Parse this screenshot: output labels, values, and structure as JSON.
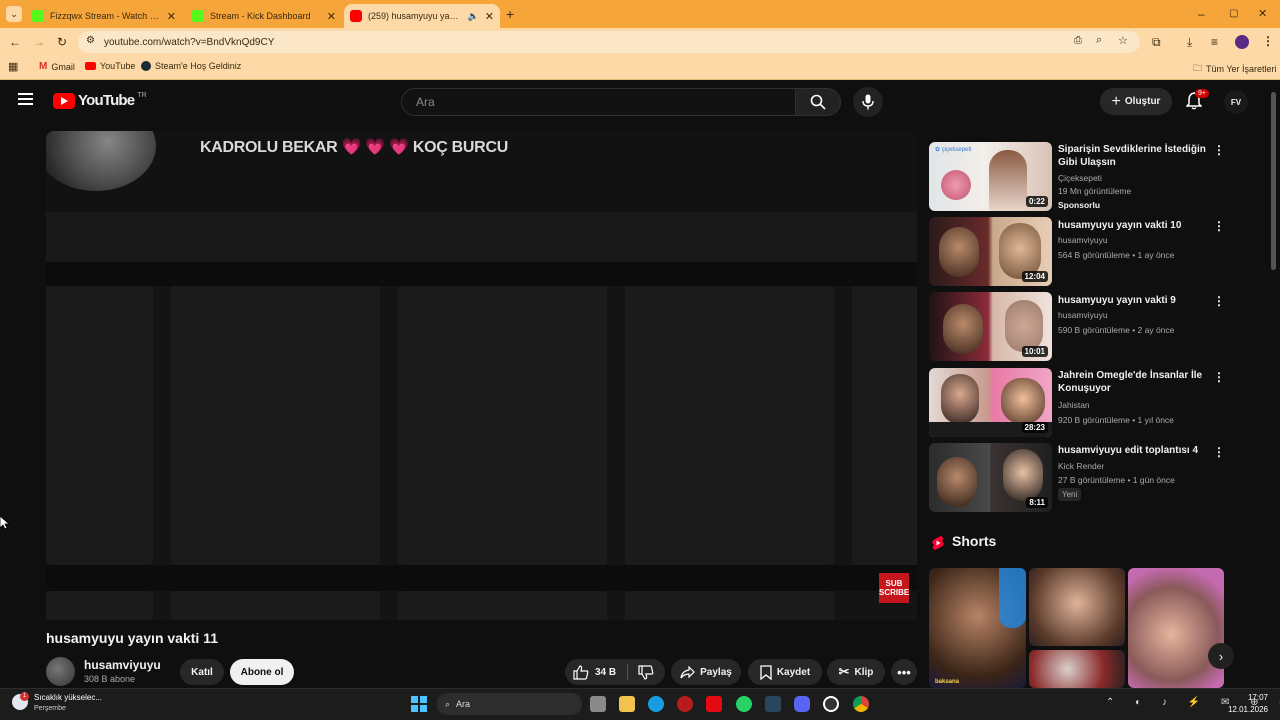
{
  "browser": {
    "tabs": [
      {
        "title": "Fizzqwx Stream - Watch Live on Kick",
        "favicon_color": "#53fc18"
      },
      {
        "title": "Stream - Kick Dashboard",
        "favicon_color": "#53fc18"
      },
      {
        "title": "(259) husamyuyu yayın vakti 11",
        "favicon_color": "#ff0000"
      }
    ],
    "url": "youtube.com/watch?v=BndVknQd9CY",
    "bookmarks": [
      "Gmail",
      "YouTube",
      "Steam'e Hoş Geldiniz"
    ],
    "all_bookmarks": "Tüm Yer İşaretleri"
  },
  "youtube": {
    "logo_text": "YouTube",
    "region": "TR",
    "search_placeholder": "Ara",
    "create_label": "Oluştur",
    "notifications": "9+",
    "account_initials": "FV"
  },
  "video": {
    "caption": "KADROLU BEKAR 💗 💗 💗 KOÇ BURCU",
    "subscribe_badge": "SUB SCRIBE",
    "title": "husamyuyu yayın vakti 11",
    "channel": "husamviyuyu",
    "subscribers": "308 B abone",
    "join_label": "Katıl",
    "subscribe_label": "Abone ol",
    "likes": "34 B",
    "share_label": "Paylaş",
    "save_label": "Kaydet",
    "clip_label": "Klip"
  },
  "recommendations": [
    {
      "title": "Siparişin Sevdiklerine İstediğin Gibi Ulaşsın",
      "channel": "Çiçeksepeti",
      "meta": "19 Mn görüntüleme",
      "badge": "Sponsorlu",
      "duration": "0:22"
    },
    {
      "title": "husamyuyu yayın vakti 10",
      "channel": "husamviyuyu",
      "meta": "564 B görüntüleme • 1 ay önce",
      "duration": "12:04"
    },
    {
      "title": "husamyuyu yayın vakti 9",
      "channel": "husamviyuyu",
      "meta": "590 B görüntüleme • 2 ay önce",
      "duration": "10:01"
    },
    {
      "title": "Jahrein Omegle'de İnsanlar İle Konuşuyor",
      "channel": "Jahistan",
      "meta": "920 B görüntüleme • 1 yıl önce",
      "duration": "28:23"
    },
    {
      "title": "husamviyuyu edit toplantısı 4",
      "channel": "Kick Render",
      "meta": "27 B görüntüleme • 1 gün önce",
      "badge": "Yeni",
      "duration": "8:11"
    }
  ],
  "shorts": {
    "title": "Shorts",
    "short_caption": "baksana"
  },
  "taskbar": {
    "weather": "Sıcaklık yükselec...",
    "weather_sub": "Perşembe",
    "search": "Ara",
    "time": "17:07",
    "date": "12.01.2026"
  }
}
